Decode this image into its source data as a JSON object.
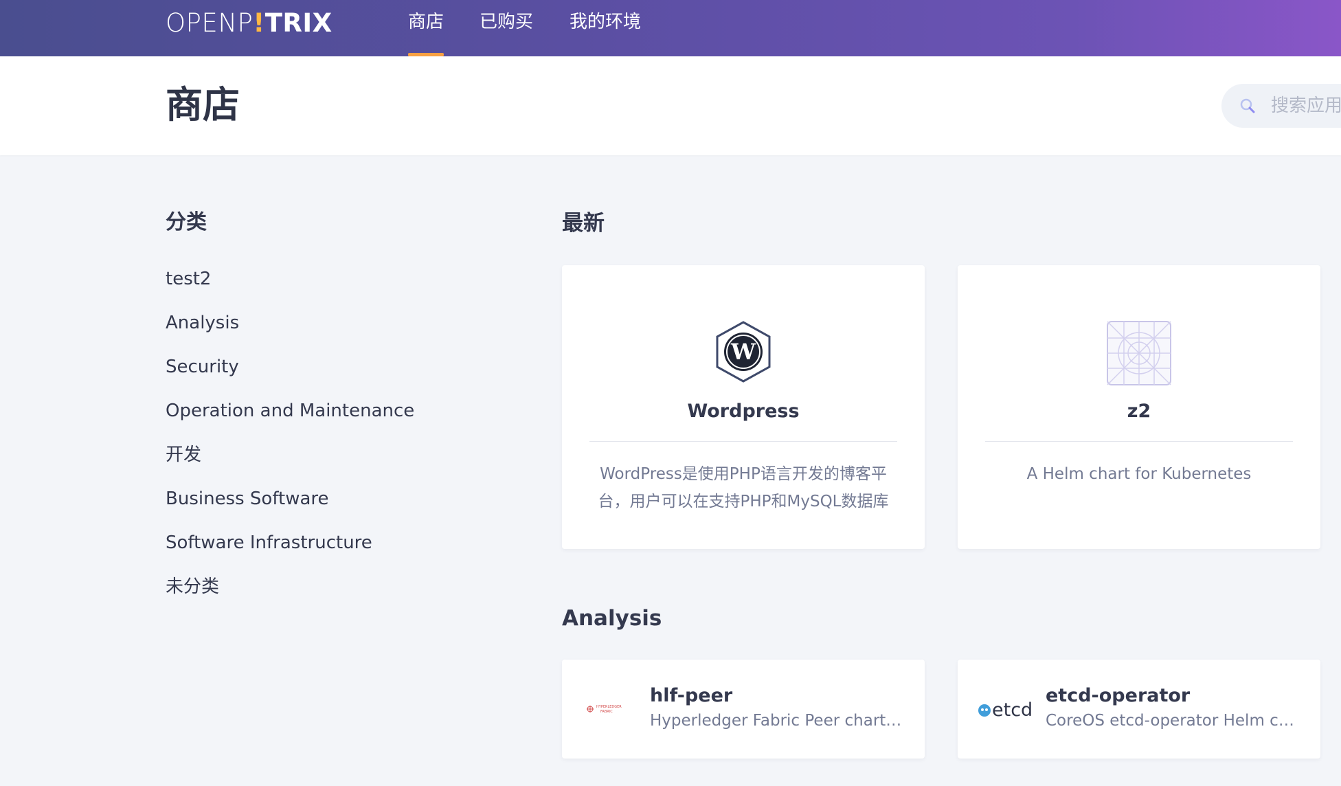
{
  "brand": {
    "logo_a": "OPEN",
    "logo_b": "P",
    "logo_bang": "!",
    "logo_c": "TRIX"
  },
  "nav": {
    "tabs": [
      {
        "label": "商店",
        "active": true
      },
      {
        "label": "已购买",
        "active": false
      },
      {
        "label": "我的环境",
        "active": false
      }
    ]
  },
  "header": {
    "title": "商店",
    "search_placeholder": "搜索应用"
  },
  "sidebar": {
    "title": "分类",
    "categories": [
      "test2",
      "Analysis",
      "Security",
      "Operation and Maintenance",
      "开发",
      "Business Software",
      "Software Infrastructure",
      "未分类"
    ]
  },
  "latest": {
    "title": "最新",
    "apps": [
      {
        "name": "Wordpress",
        "description": "WordPress是使用PHP语言开发的博客平台，用户可以在支持PHP和MySQL数据库",
        "icon": "wordpress-icon"
      },
      {
        "name": "z2",
        "description": "A Helm chart for Kubernetes",
        "icon": "app-placeholder-icon"
      }
    ]
  },
  "analysis": {
    "title": "Analysis",
    "apps": [
      {
        "name": "hlf-peer",
        "description": "Hyperledger Fabric Peer chart (t...",
        "icon": "hyperledger-fabric-icon",
        "icon_text_a": "HYPERLEDGER",
        "icon_text_b": "FABRIC"
      },
      {
        "name": "etcd-operator",
        "description": "CoreOS etcd-operator Helm char...",
        "icon": "etcd-icon",
        "icon_text": "etcd"
      }
    ]
  },
  "colors": {
    "nav_gradient_start": "#4a4e8f",
    "nav_gradient_end": "#8a56c8",
    "active_tab_indicator": "#f8a043",
    "page_background": "#f3f5f9",
    "wordpress_hex": "#3f4a6b",
    "etcd_blue": "#419eda",
    "hyperledger_red": "#d24a4a"
  }
}
